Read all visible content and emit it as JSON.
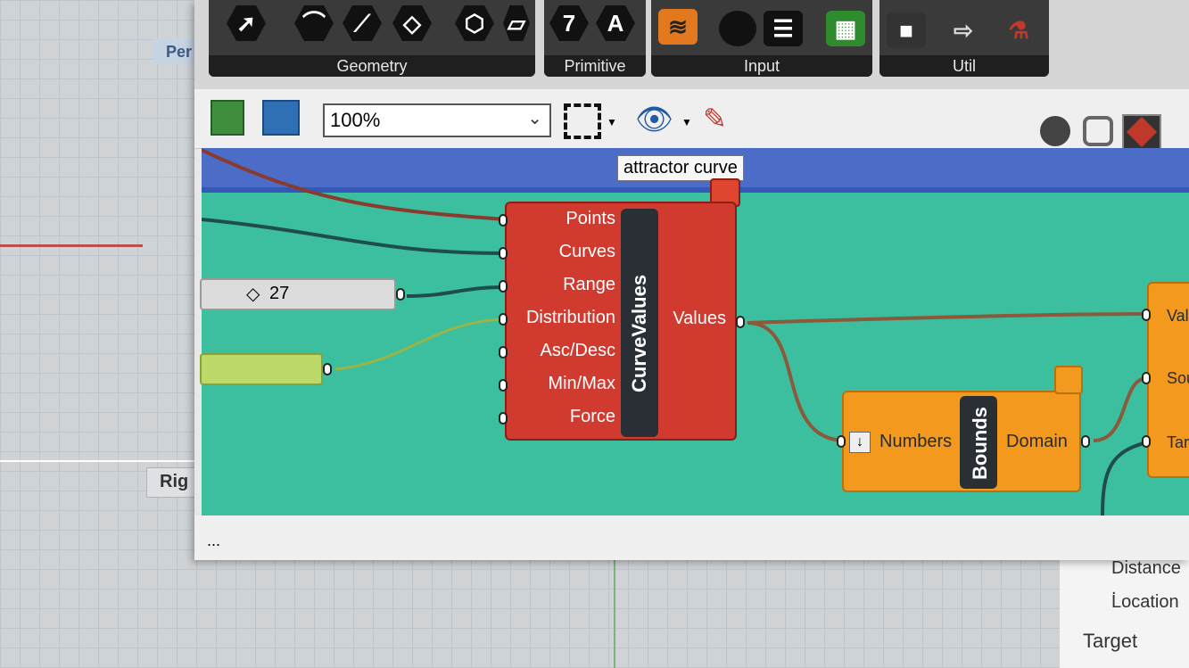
{
  "ribbon": {
    "panels": [
      "Geometry",
      "Primitive",
      "Input",
      "Util"
    ],
    "primitive_icons": [
      "7",
      "A"
    ]
  },
  "toolbar": {
    "zoom_value": "100%"
  },
  "viewport_tabs": {
    "perspective": "Per",
    "right": "Rig"
  },
  "tooltip": "attractor curve",
  "curve_values": {
    "nickname": "CurveValues",
    "inputs": [
      "Points",
      "Curves",
      "Range",
      "Distribution",
      "Asc/Desc",
      "Min/Max",
      "Force"
    ],
    "output": "Values"
  },
  "bounds": {
    "nickname": "Bounds",
    "input": "Numbers",
    "output": "Domain"
  },
  "remap_partial": {
    "inputs": [
      "Val",
      "Sou",
      "Targ"
    ]
  },
  "slider": {
    "value": "27"
  },
  "statusbar": {
    "text": "..."
  },
  "properties": {
    "items": [
      "Distance .",
      "Location",
      "Target"
    ]
  },
  "colors": {
    "canvas": "#3bbf9e",
    "component_red": "#d03a2f",
    "component_orange": "#f39a1e",
    "wire_brown": "#8a5a3a",
    "wire_dark": "#1f4d4d"
  }
}
